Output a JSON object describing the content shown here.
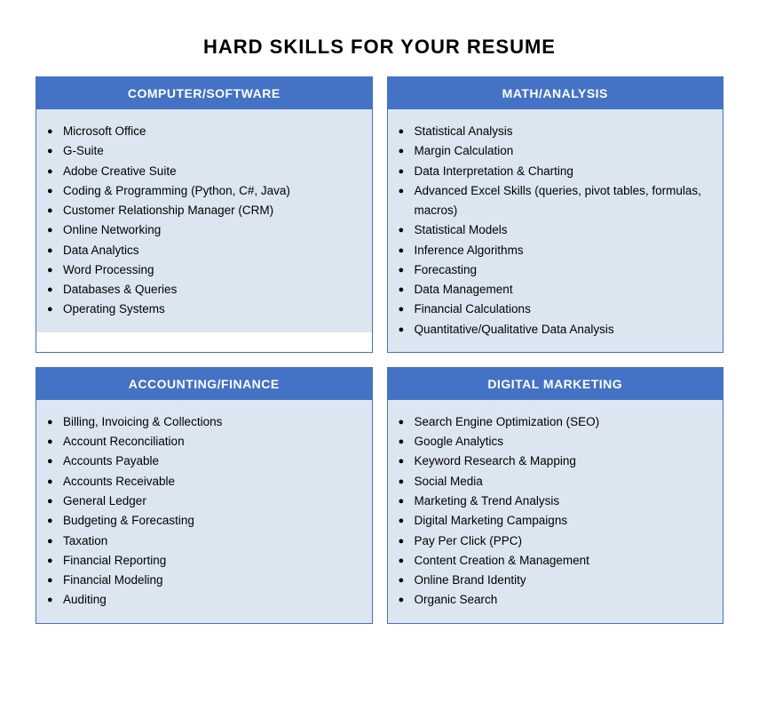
{
  "title": "HARD SKILLS FOR YOUR RESUME",
  "sections": [
    {
      "id": "computer-software",
      "header": "COMPUTER/SOFTWARE",
      "items": [
        "Microsoft Office",
        "G-Suite",
        "Adobe Creative Suite",
        "Coding & Programming (Python, C#, Java)",
        "Customer Relationship Manager (CRM)",
        "Online Networking",
        "Data Analytics",
        "Word Processing",
        "Databases & Queries",
        "Operating Systems"
      ]
    },
    {
      "id": "math-analysis",
      "header": "MATH/ANALYSIS",
      "items": [
        "Statistical Analysis",
        "Margin Calculation",
        "Data Interpretation & Charting",
        "Advanced Excel Skills (queries, pivot tables, formulas, macros)",
        "Statistical Models",
        "Inference Algorithms",
        "Forecasting",
        "Data Management",
        "Financial Calculations",
        "Quantitative/Qualitative Data Analysis"
      ]
    },
    {
      "id": "accounting-finance",
      "header": "ACCOUNTING/FINANCE",
      "items": [
        "Billing, Invoicing & Collections",
        "Account Reconciliation",
        "Accounts Payable",
        "Accounts Receivable",
        "General Ledger",
        "Budgeting & Forecasting",
        "Taxation",
        "Financial Reporting",
        "Financial Modeling",
        "Auditing"
      ]
    },
    {
      "id": "digital-marketing",
      "header": "DIGITAL MARKETING",
      "items": [
        "Search Engine Optimization (SEO)",
        "Google Analytics",
        "Keyword Research & Mapping",
        "Social Media",
        "Marketing & Trend Analysis",
        "Digital Marketing Campaigns",
        "Pay Per Click (PPC)",
        "Content Creation & Management",
        "Online Brand Identity",
        "Organic Search"
      ]
    }
  ]
}
